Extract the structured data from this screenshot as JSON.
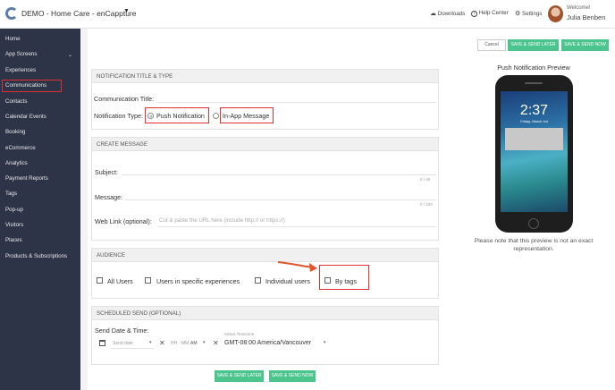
{
  "header": {
    "app_title": "DEMO - Home Care - enCappture",
    "downloads": "Downloads",
    "help_center": "Help Center",
    "settings": "Settings",
    "welcome": "Welcome!",
    "username": "Julia Benben"
  },
  "sidebar": {
    "items": [
      {
        "label": "Home"
      },
      {
        "label": "App Screens"
      },
      {
        "label": "Experiences"
      },
      {
        "label": "Communications"
      },
      {
        "label": "Contacts"
      },
      {
        "label": "Calendar Events"
      },
      {
        "label": "Booking"
      },
      {
        "label": "eCommerce"
      },
      {
        "label": "Analytics"
      },
      {
        "label": "Payment Reports"
      },
      {
        "label": "Tags"
      },
      {
        "label": "Pop-up"
      },
      {
        "label": "Visitors"
      },
      {
        "label": "Places"
      },
      {
        "label": "Products & Subscriptions"
      }
    ]
  },
  "actions": {
    "cancel": "Cancel",
    "save_send_later": "SAVE & SEND LATER",
    "save_send_now": "SAVE & SEND NOW"
  },
  "notification_section": {
    "heading": "NOTIFICATION TITLE & TYPE",
    "comm_title_label": "Communication Title:",
    "type_label": "Notification Type:",
    "push_option": "Push Notification",
    "inapp_option": "In-App Message"
  },
  "message_section": {
    "heading": "CREATE MESSAGE",
    "subject_label": "Subject:",
    "subject_counter": "0 / 40",
    "message_label": "Message:",
    "message_counter": "0 / 120",
    "weblink_label": "Web Link (optional):",
    "weblink_placeholder": "Cut & paste the URL here (include http:// or https://)"
  },
  "audience_section": {
    "heading": "AUDIENCE",
    "all_users": "All Users",
    "specific": "Users in specific experiences",
    "individual": "Individual users",
    "by_tags": "By tags"
  },
  "schedule_section": {
    "heading": "SCHEDULED SEND (OPTIONAL)",
    "label": "Send Date & Time:",
    "date_placeholder": "Send date",
    "hh": "HH",
    "mm": "MM",
    "ampm": "AM",
    "tz_label": "Select Timezone",
    "tz_value": "GMT-08:00 America/Vancouver"
  },
  "preview": {
    "title": "Push Notification Preview",
    "time": "2:37",
    "date": "Friday, March 1st",
    "note": "Please note that this preview is not an exact representation."
  },
  "colors": {
    "accent": "#4cc48e",
    "sidebar_bg": "#2d3447",
    "highlight": "#e03030"
  }
}
